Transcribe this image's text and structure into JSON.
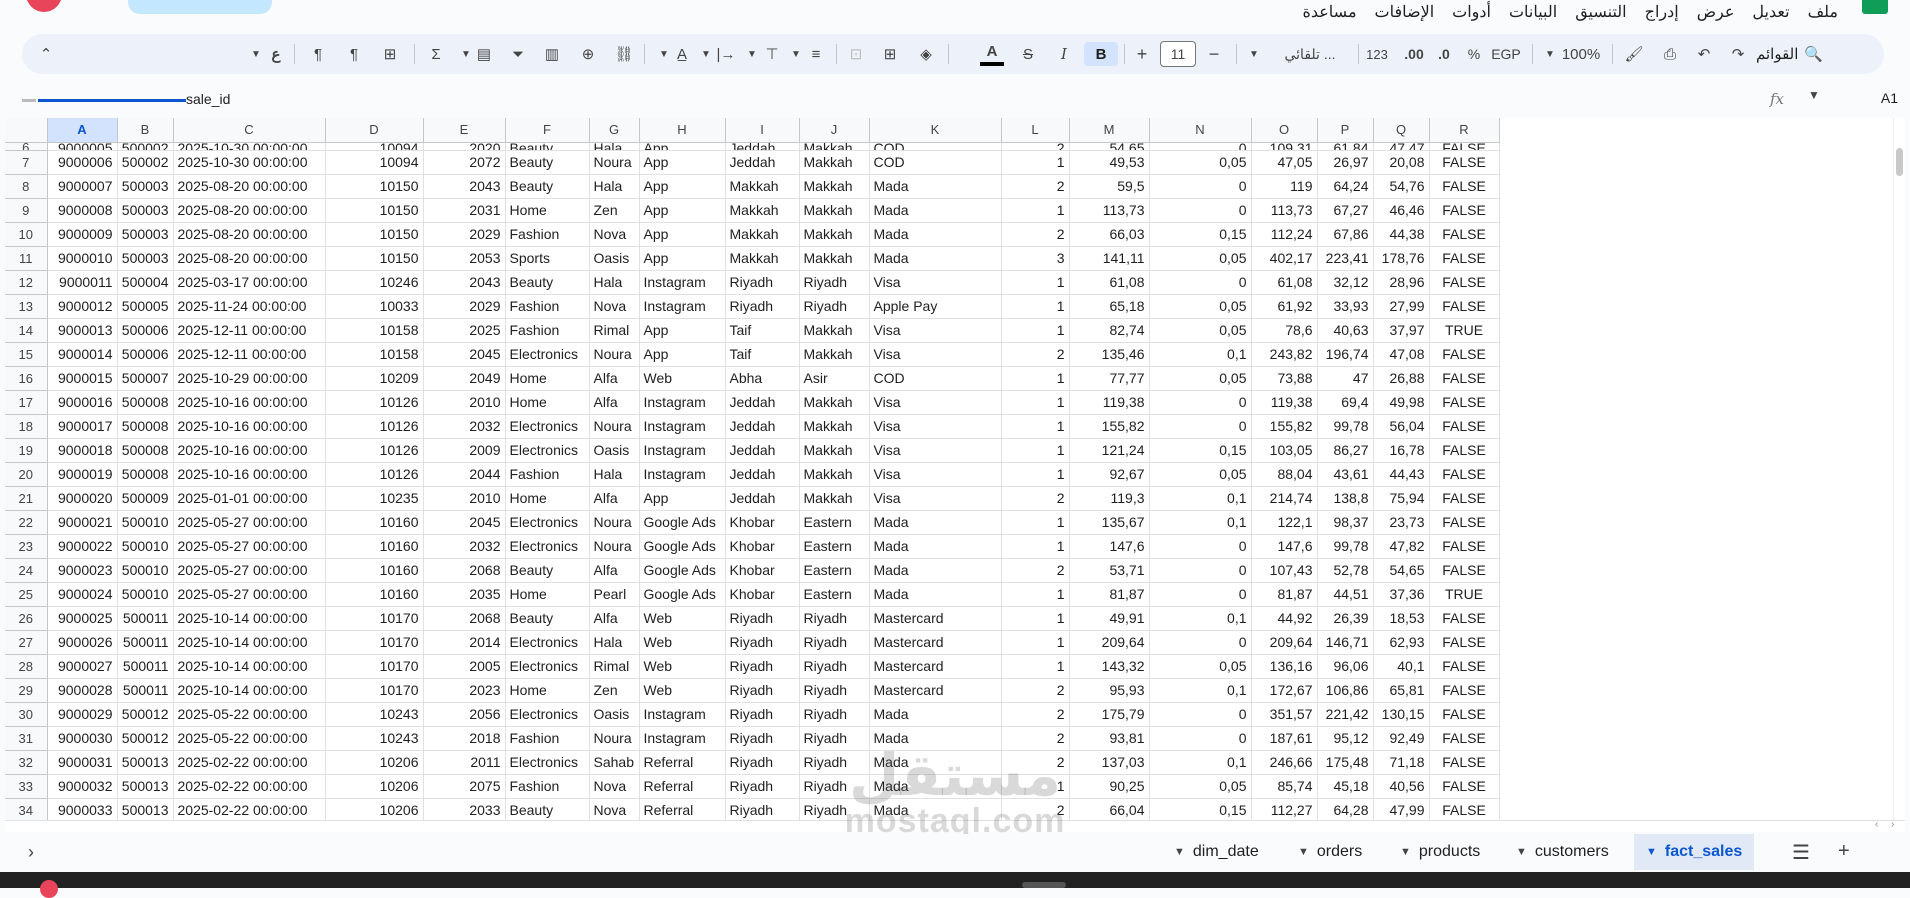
{
  "menu": [
    "ملف",
    "تعديل",
    "عرض",
    "إدراج",
    "التنسيق",
    "البيانات",
    "أدوات",
    "الإضافات",
    "مساعدة"
  ],
  "toolbar": {
    "search_label": "القوائم",
    "zoom": "100%",
    "currency": "EGP",
    "percent": "%",
    "decrease_decimal": ".0",
    "increase_decimal": ".00",
    "number_format": "123",
    "font": "تلقائي ...",
    "font_size": "11",
    "bold": "B",
    "italic": "I",
    "strikethrough": "S",
    "text_color": "A",
    "minus": "−",
    "plus": "+"
  },
  "formula_bar": {
    "cell_ref": "A1",
    "fx": "fx",
    "content": "sale_id"
  },
  "columns": [
    "A",
    "B",
    "C",
    "D",
    "E",
    "F",
    "G",
    "H",
    "I",
    "J",
    "K",
    "L",
    "M",
    "N",
    "O",
    "P",
    "Q",
    "R"
  ],
  "partial_row": [
    "6",
    "9000005",
    "500002",
    "2025-10-30 00:00:00",
    "10094",
    "2020",
    "Beauty",
    "Hala",
    "App",
    "Jeddah",
    "Makkah",
    "COD",
    "2",
    "54,65",
    "0",
    "109,31",
    "61,84",
    "47,47",
    "FALSE"
  ],
  "rows": [
    [
      "7",
      "9000006",
      "500002",
      "2025-10-30 00:00:00",
      "10094",
      "2072",
      "Beauty",
      "Noura",
      "App",
      "Jeddah",
      "Makkah",
      "COD",
      "1",
      "49,53",
      "0,05",
      "47,05",
      "26,97",
      "20,08",
      "FALSE"
    ],
    [
      "8",
      "9000007",
      "500003",
      "2025-08-20 00:00:00",
      "10150",
      "2043",
      "Beauty",
      "Hala",
      "App",
      "Makkah",
      "Makkah",
      "Mada",
      "2",
      "59,5",
      "0",
      "119",
      "64,24",
      "54,76",
      "FALSE"
    ],
    [
      "9",
      "9000008",
      "500003",
      "2025-08-20 00:00:00",
      "10150",
      "2031",
      "Home",
      "Zen",
      "App",
      "Makkah",
      "Makkah",
      "Mada",
      "1",
      "113,73",
      "0",
      "113,73",
      "67,27",
      "46,46",
      "FALSE"
    ],
    [
      "10",
      "9000009",
      "500003",
      "2025-08-20 00:00:00",
      "10150",
      "2029",
      "Fashion",
      "Nova",
      "App",
      "Makkah",
      "Makkah",
      "Mada",
      "2",
      "66,03",
      "0,15",
      "112,24",
      "67,86",
      "44,38",
      "FALSE"
    ],
    [
      "11",
      "9000010",
      "500003",
      "2025-08-20 00:00:00",
      "10150",
      "2053",
      "Sports",
      "Oasis",
      "App",
      "Makkah",
      "Makkah",
      "Mada",
      "3",
      "141,11",
      "0,05",
      "402,17",
      "223,41",
      "178,76",
      "FALSE"
    ],
    [
      "12",
      "9000011",
      "500004",
      "2025-03-17 00:00:00",
      "10246",
      "2043",
      "Beauty",
      "Hala",
      "Instagram",
      "Riyadh",
      "Riyadh",
      "Visa",
      "1",
      "61,08",
      "0",
      "61,08",
      "32,12",
      "28,96",
      "FALSE"
    ],
    [
      "13",
      "9000012",
      "500005",
      "2025-11-24 00:00:00",
      "10033",
      "2029",
      "Fashion",
      "Nova",
      "Instagram",
      "Riyadh",
      "Riyadh",
      "Apple Pay",
      "1",
      "65,18",
      "0,05",
      "61,92",
      "33,93",
      "27,99",
      "FALSE"
    ],
    [
      "14",
      "9000013",
      "500006",
      "2025-12-11 00:00:00",
      "10158",
      "2025",
      "Fashion",
      "Rimal",
      "App",
      "Taif",
      "Makkah",
      "Visa",
      "1",
      "82,74",
      "0,05",
      "78,6",
      "40,63",
      "37,97",
      "TRUE"
    ],
    [
      "15",
      "9000014",
      "500006",
      "2025-12-11 00:00:00",
      "10158",
      "2045",
      "Electronics",
      "Noura",
      "App",
      "Taif",
      "Makkah",
      "Visa",
      "2",
      "135,46",
      "0,1",
      "243,82",
      "196,74",
      "47,08",
      "FALSE"
    ],
    [
      "16",
      "9000015",
      "500007",
      "2025-10-29 00:00:00",
      "10209",
      "2049",
      "Home",
      "Alfa",
      "Web",
      "Abha",
      "Asir",
      "COD",
      "1",
      "77,77",
      "0,05",
      "73,88",
      "47",
      "26,88",
      "FALSE"
    ],
    [
      "17",
      "9000016",
      "500008",
      "2025-10-16 00:00:00",
      "10126",
      "2010",
      "Home",
      "Alfa",
      "Instagram",
      "Jeddah",
      "Makkah",
      "Visa",
      "1",
      "119,38",
      "0",
      "119,38",
      "69,4",
      "49,98",
      "FALSE"
    ],
    [
      "18",
      "9000017",
      "500008",
      "2025-10-16 00:00:00",
      "10126",
      "2032",
      "Electronics",
      "Noura",
      "Instagram",
      "Jeddah",
      "Makkah",
      "Visa",
      "1",
      "155,82",
      "0",
      "155,82",
      "99,78",
      "56,04",
      "FALSE"
    ],
    [
      "19",
      "9000018",
      "500008",
      "2025-10-16 00:00:00",
      "10126",
      "2009",
      "Electronics",
      "Oasis",
      "Instagram",
      "Jeddah",
      "Makkah",
      "Visa",
      "1",
      "121,24",
      "0,15",
      "103,05",
      "86,27",
      "16,78",
      "FALSE"
    ],
    [
      "20",
      "9000019",
      "500008",
      "2025-10-16 00:00:00",
      "10126",
      "2044",
      "Fashion",
      "Hala",
      "Instagram",
      "Jeddah",
      "Makkah",
      "Visa",
      "1",
      "92,67",
      "0,05",
      "88,04",
      "43,61",
      "44,43",
      "FALSE"
    ],
    [
      "21",
      "9000020",
      "500009",
      "2025-01-01 00:00:00",
      "10235",
      "2010",
      "Home",
      "Alfa",
      "App",
      "Jeddah",
      "Makkah",
      "Visa",
      "2",
      "119,3",
      "0,1",
      "214,74",
      "138,8",
      "75,94",
      "FALSE"
    ],
    [
      "22",
      "9000021",
      "500010",
      "2025-05-27 00:00:00",
      "10160",
      "2045",
      "Electronics",
      "Noura",
      "Google Ads",
      "Khobar",
      "Eastern",
      "Mada",
      "1",
      "135,67",
      "0,1",
      "122,1",
      "98,37",
      "23,73",
      "FALSE"
    ],
    [
      "23",
      "9000022",
      "500010",
      "2025-05-27 00:00:00",
      "10160",
      "2032",
      "Electronics",
      "Noura",
      "Google Ads",
      "Khobar",
      "Eastern",
      "Mada",
      "1",
      "147,6",
      "0",
      "147,6",
      "99,78",
      "47,82",
      "FALSE"
    ],
    [
      "24",
      "9000023",
      "500010",
      "2025-05-27 00:00:00",
      "10160",
      "2068",
      "Beauty",
      "Alfa",
      "Google Ads",
      "Khobar",
      "Eastern",
      "Mada",
      "2",
      "53,71",
      "0",
      "107,43",
      "52,78",
      "54,65",
      "FALSE"
    ],
    [
      "25",
      "9000024",
      "500010",
      "2025-05-27 00:00:00",
      "10160",
      "2035",
      "Home",
      "Pearl",
      "Google Ads",
      "Khobar",
      "Eastern",
      "Mada",
      "1",
      "81,87",
      "0",
      "81,87",
      "44,51",
      "37,36",
      "TRUE"
    ],
    [
      "26",
      "9000025",
      "500011",
      "2025-10-14 00:00:00",
      "10170",
      "2068",
      "Beauty",
      "Alfa",
      "Web",
      "Riyadh",
      "Riyadh",
      "Mastercard",
      "1",
      "49,91",
      "0,1",
      "44,92",
      "26,39",
      "18,53",
      "FALSE"
    ],
    [
      "27",
      "9000026",
      "500011",
      "2025-10-14 00:00:00",
      "10170",
      "2014",
      "Electronics",
      "Hala",
      "Web",
      "Riyadh",
      "Riyadh",
      "Mastercard",
      "1",
      "209,64",
      "0",
      "209,64",
      "146,71",
      "62,93",
      "FALSE"
    ],
    [
      "28",
      "9000027",
      "500011",
      "2025-10-14 00:00:00",
      "10170",
      "2005",
      "Electronics",
      "Rimal",
      "Web",
      "Riyadh",
      "Riyadh",
      "Mastercard",
      "1",
      "143,32",
      "0,05",
      "136,16",
      "96,06",
      "40,1",
      "FALSE"
    ],
    [
      "29",
      "9000028",
      "500011",
      "2025-10-14 00:00:00",
      "10170",
      "2023",
      "Home",
      "Zen",
      "Web",
      "Riyadh",
      "Riyadh",
      "Mastercard",
      "2",
      "95,93",
      "0,1",
      "172,67",
      "106,86",
      "65,81",
      "FALSE"
    ],
    [
      "30",
      "9000029",
      "500012",
      "2025-05-22 00:00:00",
      "10243",
      "2056",
      "Electronics",
      "Oasis",
      "Instagram",
      "Riyadh",
      "Riyadh",
      "Mada",
      "2",
      "175,79",
      "0",
      "351,57",
      "221,42",
      "130,15",
      "FALSE"
    ],
    [
      "31",
      "9000030",
      "500012",
      "2025-05-22 00:00:00",
      "10243",
      "2018",
      "Fashion",
      "Noura",
      "Instagram",
      "Riyadh",
      "Riyadh",
      "Mada",
      "2",
      "93,81",
      "0",
      "187,61",
      "95,12",
      "92,49",
      "FALSE"
    ],
    [
      "32",
      "9000031",
      "500013",
      "2025-02-22 00:00:00",
      "10206",
      "2011",
      "Electronics",
      "Sahab",
      "Referral",
      "Riyadh",
      "Riyadh",
      "Mada",
      "2",
      "137,03",
      "0,1",
      "246,66",
      "175,48",
      "71,18",
      "FALSE"
    ],
    [
      "33",
      "9000032",
      "500013",
      "2025-02-22 00:00:00",
      "10206",
      "2075",
      "Fashion",
      "Nova",
      "Referral",
      "Riyadh",
      "Riyadh",
      "Mada",
      "1",
      "90,25",
      "0,05",
      "85,74",
      "45,18",
      "40,56",
      "FALSE"
    ],
    [
      "34",
      "9000033",
      "500013",
      "2025-02-22 00:00:00",
      "10206",
      "2033",
      "Beauty",
      "Nova",
      "Referral",
      "Riyadh",
      "Riyadh",
      "Mada",
      "2",
      "66,04",
      "0,15",
      "112,27",
      "64,28",
      "47,99",
      "FALSE"
    ]
  ],
  "sheet_tabs": [
    "dim_date",
    "orders",
    "products",
    "customers",
    "fact_sales"
  ],
  "active_tab": "fact_sales",
  "watermark": {
    "ar": "مستقل",
    "en": "mostaql.com"
  },
  "colors": {
    "accent": "#0b57d0",
    "toolbar_bg": "#edf2fa",
    "selected_header": "#d3e3fd"
  }
}
